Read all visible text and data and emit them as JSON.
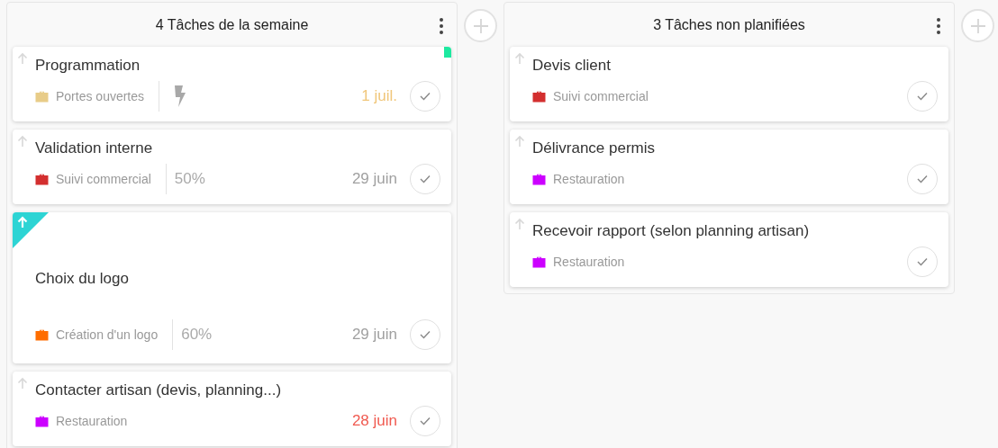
{
  "columns": [
    {
      "title": "4 Tâches de la semaine",
      "cards": [
        {
          "title": "Programmation",
          "high_priority": false,
          "color": "#1de9a0",
          "project": {
            "name": "Portes ouvertes",
            "color": "#e8cc88"
          },
          "extra": {
            "kind": "lightning"
          },
          "due": {
            "text": "1 juil.",
            "color": "#f0c67a"
          }
        },
        {
          "title": "Validation interne",
          "high_priority": false,
          "project": {
            "name": "Suivi commercial",
            "color": "#d32f2f"
          },
          "extra": {
            "kind": "progress",
            "text": "50%"
          },
          "due": {
            "text": "29 juin",
            "color": "#a0a0a0"
          }
        },
        {
          "title": "Choix du logo",
          "high_priority": true,
          "project": {
            "name": "Création d'un logo",
            "color": "#ff6d00"
          },
          "extra": {
            "kind": "progress",
            "text": "60%"
          },
          "due": {
            "text": "29 juin",
            "color": "#a0a0a0"
          }
        },
        {
          "title": "Contacter artisan (devis, planning...)",
          "high_priority": false,
          "project": {
            "name": "Restauration",
            "color": "#cc00ff"
          },
          "due": {
            "text": "28 juin",
            "color": "#f05a50"
          }
        }
      ]
    },
    {
      "title": "3 Tâches non planifiées",
      "cards": [
        {
          "title": "Devis client",
          "high_priority": false,
          "project": {
            "name": "Suivi commercial",
            "color": "#d32f2f"
          }
        },
        {
          "title": "Délivrance permis",
          "high_priority": false,
          "project": {
            "name": "Restauration",
            "color": "#cc00ff"
          }
        },
        {
          "title": "Recevoir rapport (selon planning artisan)",
          "high_priority": false,
          "project": {
            "name": "Restauration",
            "color": "#cc00ff"
          }
        }
      ]
    }
  ]
}
